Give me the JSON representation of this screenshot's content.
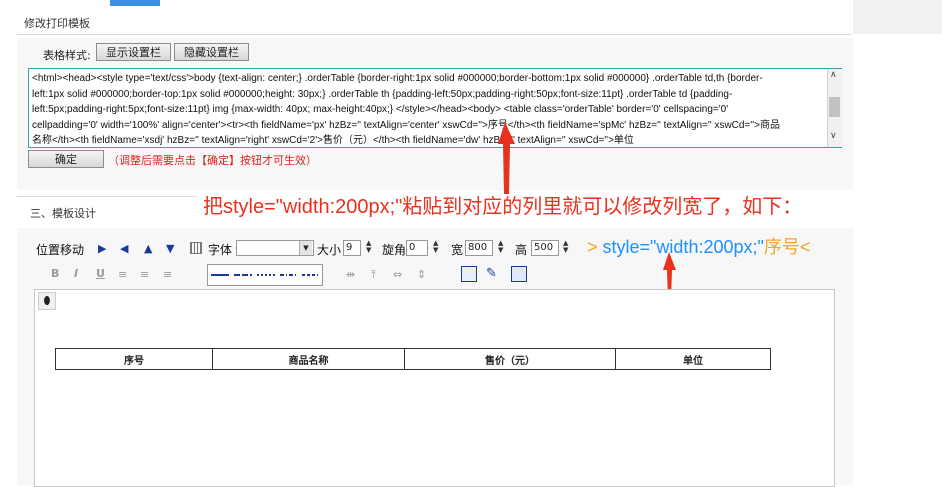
{
  "page_title": "修改打印模板",
  "table_style": {
    "label": "表格样式:",
    "show_btn": "显示设置栏",
    "hide_btn": "隐藏设置栏",
    "code_lines": [
      "<html><head><style type='text/css'>body {text-align: center;}   .orderTable {border-right:1px solid #000000;border-bottom:1px solid #000000} .orderTable td,th {border-",
      "left:1px solid #000000;border-top:1px solid #000000;height: 30px;} .orderTable th {padding-left:50px;padding-right:50px;font-size:11pt} .orderTable td {padding-",
      "left:5px;padding-right:5px;font-size:11pt} img {max-width: 40px; max-height:40px;} </style></head><body>  <table class='orderTable' border='0' cellspacing='0'",
      "cellpadding='0' width='100%' align='center'><tr><th fieldName='px' hzBz='' textAlign='center' xswCd=''>序号</th><th fieldName='spMc' hzBz='' textAlign='' xswCd=''>商品",
      "名称</th><th fieldName='xsdj' hzBz='' textAlign='right' xswCd='2'>售价（元）</th><th fieldName='dw' hzBz='' textAlign='' xswCd=''>单位"
    ],
    "confirm_btn": "确定",
    "note": "（调整后需要点击【确定】按钮才可生效）"
  },
  "annotations": {
    "main": "把style=\"width:200px;\"粘贴到对应的列里就可以修改列宽了，如下：",
    "code_prefix": "> ",
    "code_style": "style=\"width:200px;\"",
    "code_suffix": "序号<",
    "color_prefix": "#f5a623",
    "color_code": "#1e90ff",
    "color_red": "#e8321e"
  },
  "design": {
    "title": "三、模板设计",
    "toolbar": {
      "position_move": "位置移动",
      "font_label": "字体",
      "size_label": "大小",
      "size_value": "9",
      "rotate_label": "旋角",
      "rotate_value": "0",
      "width_label": "宽",
      "width_value": "800",
      "height_label": "高",
      "height_value": "500",
      "bold": "B",
      "italic": "I",
      "underline": "U"
    },
    "columns": [
      "序号",
      "商品名称",
      "售价（元）",
      "单位"
    ]
  }
}
